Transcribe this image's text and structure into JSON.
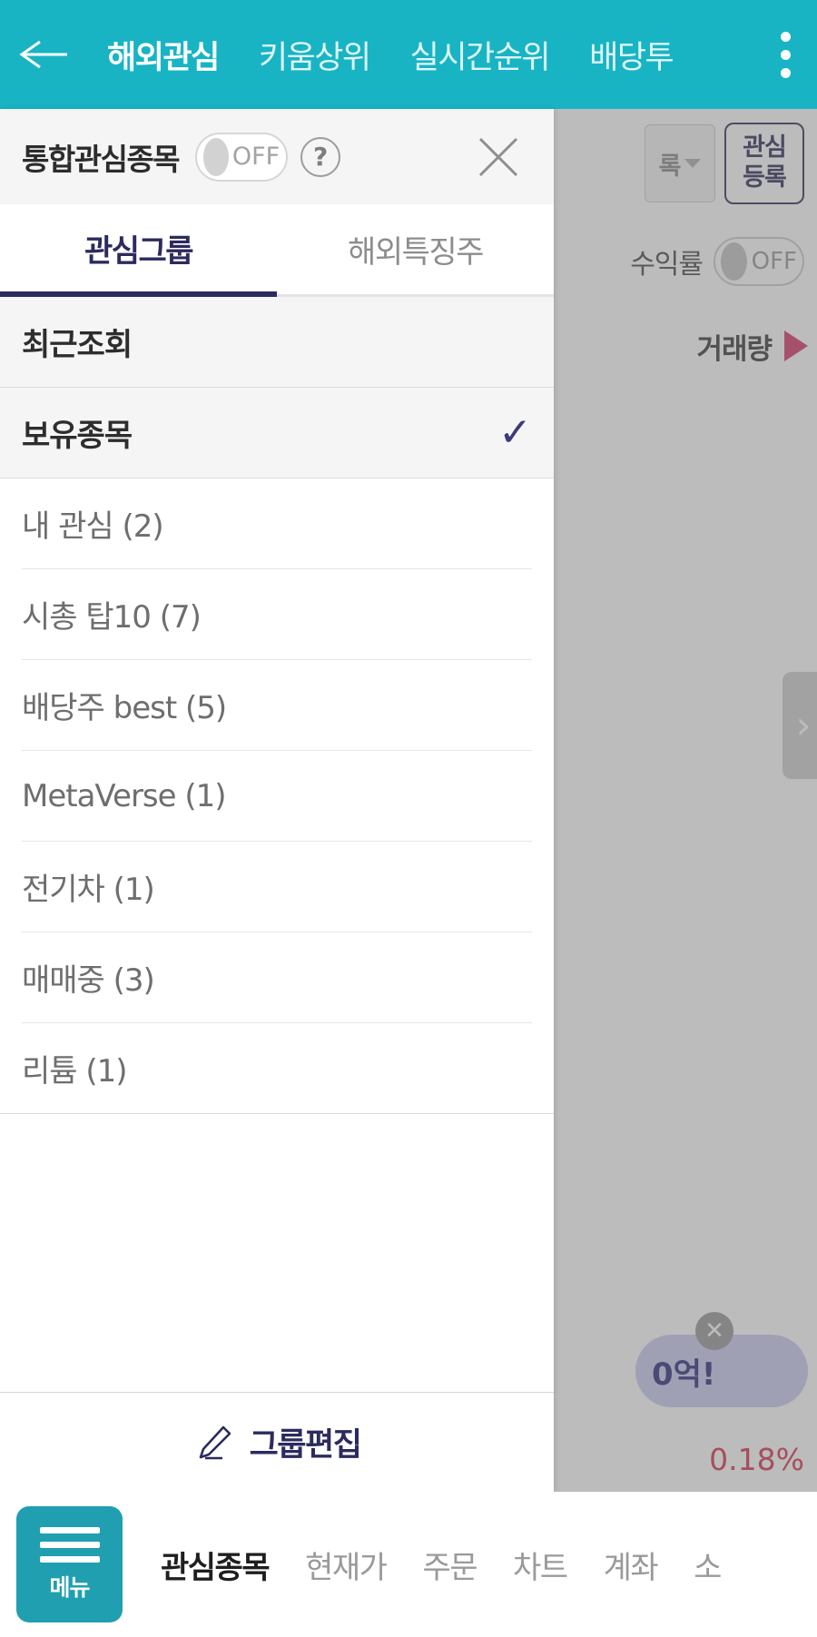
{
  "topbar": {
    "back_icon": "back-arrow-icon",
    "menu_icon": "kebab-menu-icon",
    "tabs": [
      {
        "label": "해외관심",
        "active": true
      },
      {
        "label": "키움상위",
        "active": false
      },
      {
        "label": "실시간순위",
        "active": false
      },
      {
        "label": "배당투",
        "active": false
      }
    ],
    "background_color": "#18b4c4"
  },
  "panel": {
    "title": "통합관심종목",
    "toggle": {
      "state_label": "OFF",
      "on": false
    },
    "help_label": "?",
    "close_label": "✕",
    "tabs": [
      {
        "label": "관심그룹",
        "active": true
      },
      {
        "label": "해외특징주",
        "active": false
      }
    ],
    "groups": [
      {
        "label": "최근조회",
        "shaded": true,
        "checked": false
      },
      {
        "label": "보유종목",
        "shaded": true,
        "checked": true
      },
      {
        "label": "내 관심 (2)",
        "shaded": false,
        "checked": false
      },
      {
        "label": "시총 탑10 (7)",
        "shaded": false,
        "checked": false
      },
      {
        "label": "배당주 best (5)",
        "shaded": false,
        "checked": false
      },
      {
        "label": "MetaVerse (1)",
        "shaded": false,
        "checked": false
      },
      {
        "label": "전기차 (1)",
        "shaded": false,
        "checked": false
      },
      {
        "label": "매매중 (3)",
        "shaded": false,
        "checked": false
      },
      {
        "label": "리튬 (1)",
        "shaded": false,
        "checked": false
      }
    ],
    "check_glyph": "✓",
    "edit_button": {
      "label": "그룹편집",
      "icon": "pencil-icon"
    },
    "accent_color": "#2b2b5e"
  },
  "background_screen": {
    "group_select_text": "록",
    "register_button": {
      "line1": "관심",
      "line2": "등록"
    },
    "yield_label": "수익률",
    "yield_toggle_state": "OFF",
    "volume_label": "거래량",
    "chevron_label": "›",
    "toast_text": "0억!",
    "toast_close": "✕",
    "percent_text": "0.18%",
    "percent_color": "#d8344f"
  },
  "bottom_nav": {
    "menu_button": {
      "label": "메뉴",
      "icon": "hamburger-icon",
      "color": "#1f9fb0"
    },
    "items": [
      {
        "label": "관심종목",
        "active": true
      },
      {
        "label": "현재가",
        "active": false
      },
      {
        "label": "주문",
        "active": false
      },
      {
        "label": "차트",
        "active": false
      },
      {
        "label": "계좌",
        "active": false
      },
      {
        "label": "소",
        "active": false
      }
    ]
  }
}
